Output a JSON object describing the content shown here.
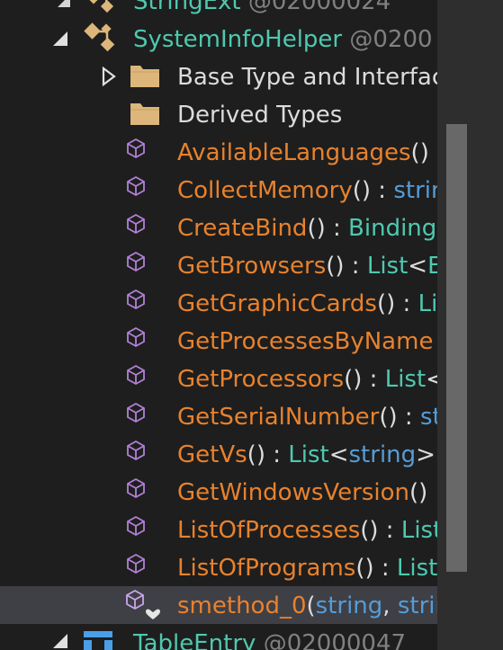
{
  "colors": {
    "background": "#1e1e1e",
    "method": "#e8822d",
    "keyword": "#569cd6",
    "type": "#4ec9b0",
    "punct": "#dcdcdc",
    "folder": "#dcb67a",
    "method_icon": "#b180d7",
    "selection": "#3f3f46"
  },
  "tree": {
    "partial_top": {
      "name": "StringExt",
      "token": "@02000024"
    },
    "class_node": {
      "name": "SystemInfoHelper",
      "token": "@0200"
    },
    "base_types": "Base Type and Interfac",
    "derived_types": "Derived Types",
    "members": [
      {
        "name": "AvailableLanguages",
        "sig": "()",
        "sep": " : ",
        "ret": ""
      },
      {
        "name": "CollectMemory",
        "sig": "()",
        "sep": " : ",
        "ret": "strin"
      },
      {
        "name": "CreateBind",
        "sig": "()",
        "sep": " : ",
        "ret": "Binding"
      },
      {
        "name": "GetBrowsers",
        "sig": "()",
        "sep": " : ",
        "ret": "List",
        "lt": "<",
        "gen": "Er"
      },
      {
        "name": "GetGraphicCards",
        "sig": "()",
        "sep": " : ",
        "ret": "Lis"
      },
      {
        "name": "GetProcessesByName",
        "sig": "",
        "sep": "",
        "ret": ""
      },
      {
        "name": "GetProcessors",
        "sig": "()",
        "sep": " : ",
        "ret": "List",
        "lt": "<",
        "gen": ""
      },
      {
        "name": "GetSerialNumber",
        "sig": "()",
        "sep": " : ",
        "ret": "st"
      },
      {
        "name": "GetVs",
        "sig": "()",
        "sep": " : ",
        "ret": "List",
        "lt": "<",
        "gen": "string",
        "gt": ">"
      },
      {
        "name": "GetWindowsVersion",
        "sig": "()",
        "sep": "",
        "ret": ""
      },
      {
        "name": "ListOfProcesses",
        "sig": "()",
        "sep": " : ",
        "ret": "List"
      },
      {
        "name": "ListOfPrograms",
        "sig": "()",
        "sep": " : ",
        "ret": "List"
      }
    ],
    "selected_member": {
      "name": "smethod_0",
      "open": "(",
      "arg1": "string",
      "comma": ", ",
      "arg2": "strin"
    },
    "partial_bottom": {
      "name": "TableEntry",
      "token": "@02000047"
    }
  },
  "icons": {
    "expanded": "triangle-expanded-icon",
    "collapsed": "triangle-collapsed-icon",
    "class": "class-icon",
    "folder": "folder-icon",
    "method": "method-cube-icon",
    "internal_method": "internal-method-icon",
    "table": "table-icon"
  }
}
